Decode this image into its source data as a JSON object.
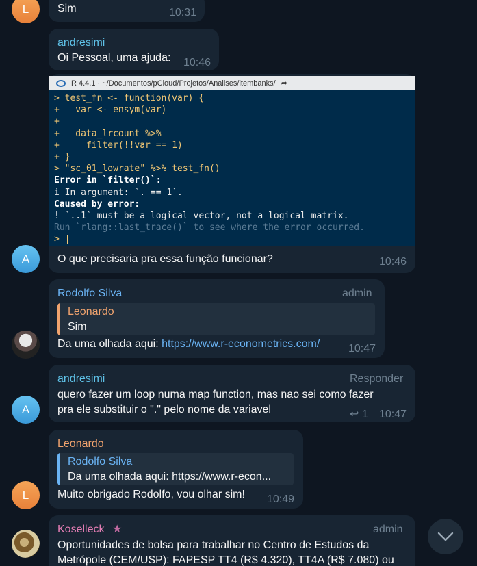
{
  "colors": {
    "background": "#0e1621",
    "bubble": "#182533",
    "link": "#6ab3f3",
    "terminal_bg": "#002b4a"
  },
  "messages": [
    {
      "avatar_letter": "L",
      "text": "Sim",
      "time": "10:31"
    },
    {
      "avatar_letter": "A",
      "sender": "andresimi",
      "text": "Oi Pessoal, uma ajuda:",
      "time": "10:46"
    },
    {
      "caption": "O que precisaria pra essa função funcionar?",
      "time": "10:46"
    },
    {
      "sender": "Rodolfo Silva",
      "role": "admin",
      "reply_to": {
        "sender": "Leonardo",
        "text": "Sim"
      },
      "text_prefix": "Da uma olhada aqui: ",
      "link": "https://www.r-econometrics.com/",
      "time": "10:47"
    },
    {
      "avatar_letter": "A",
      "sender": "andresimi",
      "action": "Responder",
      "line1": "quero fazer um loop numa map function, mas nao sei como fazer",
      "line2": "pra ele substituir o \".\" pelo nome da variavel",
      "reply_count": "1",
      "time": "10:47"
    },
    {
      "avatar_letter": "L",
      "sender": "Leonardo",
      "reply_to": {
        "sender": "Rodolfo Silva",
        "text": "Da uma olhada aqui: https://www.r-econ..."
      },
      "text": "Muito obrigado Rodolfo, vou olhar sim!",
      "time": "10:49"
    },
    {
      "sender": "Koselleck",
      "role": "admin",
      "line1": "Oportunidades de bolsa para trabalhar no Centro de Estudos da",
      "line2": "Metrópole (CEM/USP): FAPESP TT4 (R$ 4.320), TT4A (R$ 7.080) ou"
    }
  ],
  "terminal": {
    "title": "R 4.4.1 · ~/Documentos/pCloud/Projetos/Analises/itembanks/",
    "lines": [
      "> test_fn <- function(var) {",
      "+   var <- ensym(var)",
      "+",
      "+   data_lrcount %>%",
      "+     filter(!!var == 1)",
      "+ }",
      "> \"sc_01_lowrate\" %>% test_fn()",
      "Error in `filter()`:",
      "i In argument: `. == 1`.",
      "Caused by error:",
      "! `..1` must be a logical vector, not a logical matrix.",
      "Run `rlang::last_trace()` to see where the error occurred.",
      "> |"
    ]
  }
}
